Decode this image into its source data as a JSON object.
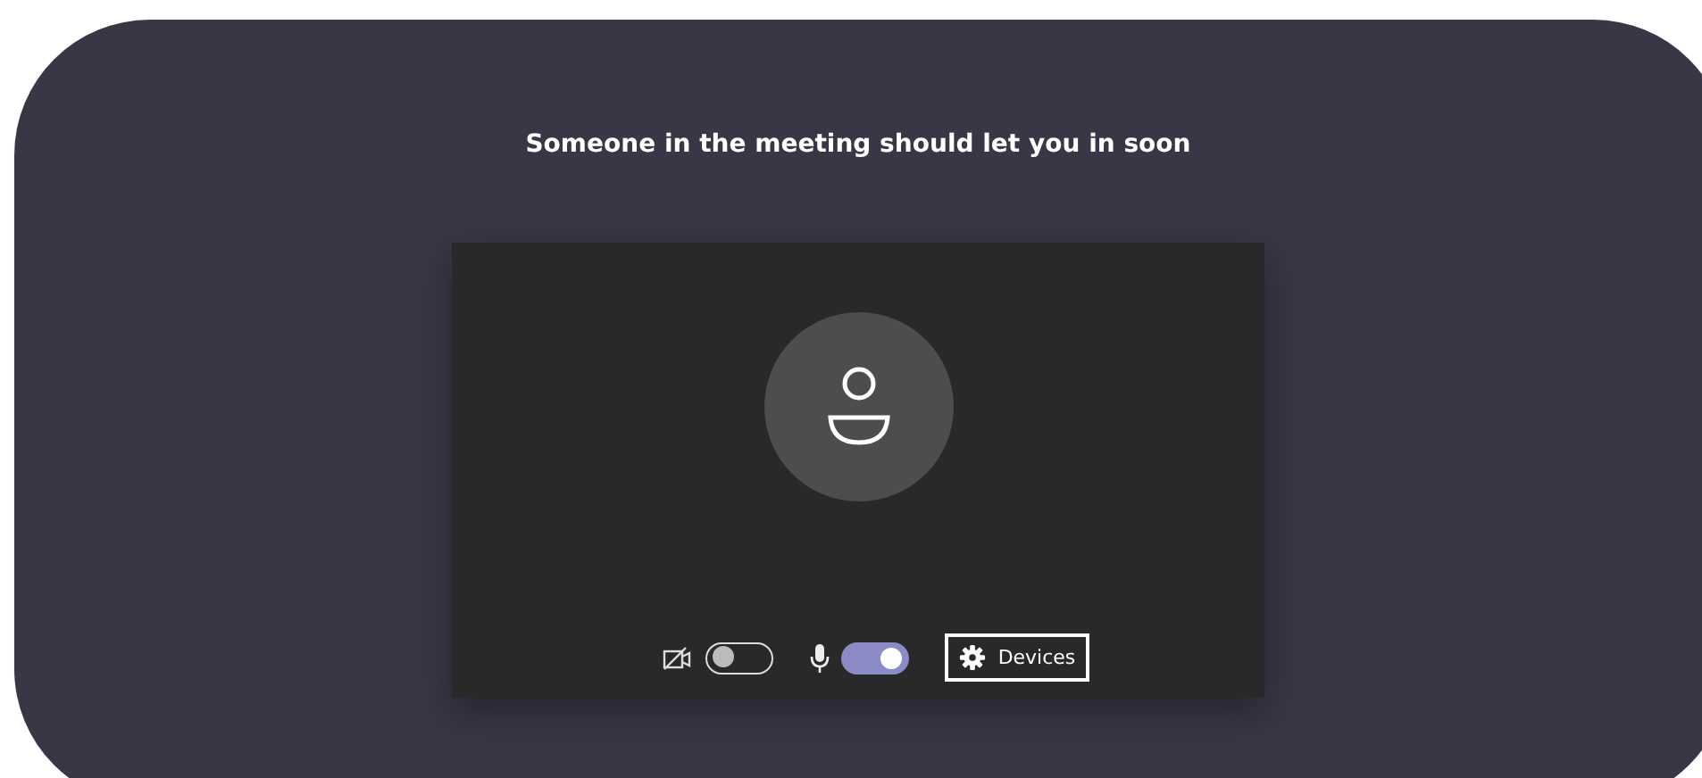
{
  "title": "Someone in the meeting should let you in soon",
  "controls": [
    {
      "kind": "camera",
      "on": false
    },
    {
      "kind": "mic",
      "on": true
    }
  ],
  "devices_button": {
    "label": "Devices"
  }
}
